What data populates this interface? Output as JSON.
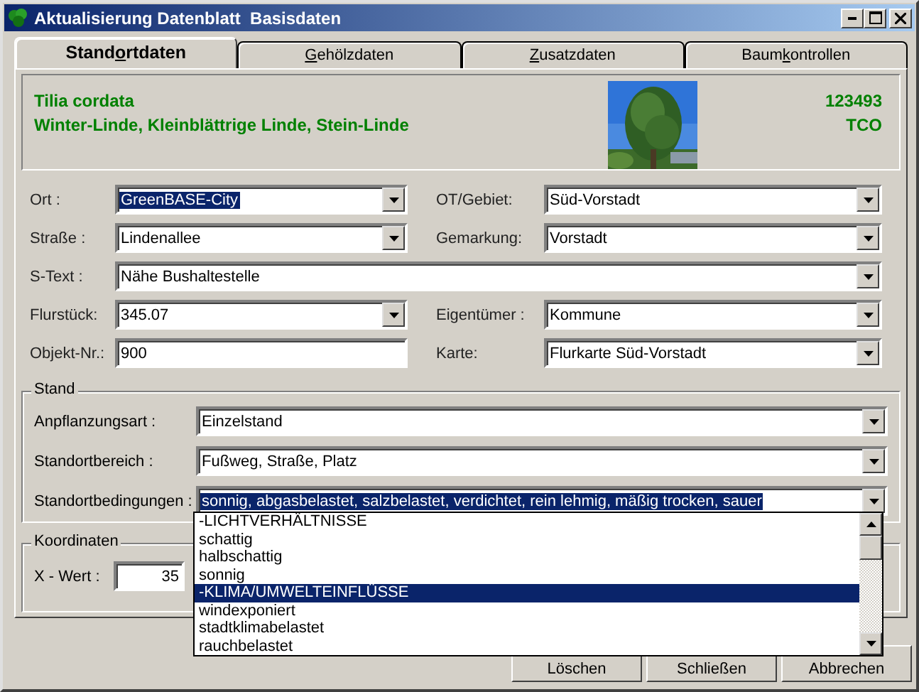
{
  "window": {
    "title": "Aktualisierung Datenblatt  Basisdaten"
  },
  "tabs": [
    {
      "before": "Stand",
      "mnemonic": "o",
      "after": "rtdaten",
      "selected": true
    },
    {
      "mnemonic": "G",
      "after": "ehölzdaten",
      "selected": false
    },
    {
      "mnemonic": "Z",
      "after": "usatzdaten",
      "selected": false
    },
    {
      "before": "Baum",
      "mnemonic": "k",
      "after": "ontrollen",
      "selected": false
    }
  ],
  "header": {
    "species": "Tilia cordata",
    "common_names": "Winter-Linde, Kleinblättrige Linde, Stein-Linde",
    "number": "123493",
    "code": "TCO"
  },
  "rows": [
    {
      "fields": [
        {
          "label": "Ort :",
          "value": "GreenBASE-City",
          "kind": "combo",
          "highlighted": true
        },
        {
          "label": "OT/Gebiet:",
          "value": "Süd-Vorstadt",
          "kind": "combo",
          "highlighted": false
        }
      ]
    },
    {
      "fields": [
        {
          "label": "Straße :",
          "value": "Lindenallee",
          "kind": "combo",
          "highlighted": false
        },
        {
          "label": "Gemarkung:",
          "value": "Vorstadt",
          "kind": "combo",
          "highlighted": false
        }
      ]
    },
    {
      "fields": [
        {
          "label": "S-Text :",
          "value": "Nähe Bushaltestelle",
          "kind": "combo",
          "highlighted": false
        }
      ]
    },
    {
      "fields": [
        {
          "label": "Flurstück:",
          "value": "345.07",
          "kind": "combo",
          "highlighted": false
        },
        {
          "label": "Eigentümer :",
          "value": "Kommune",
          "kind": "combo",
          "highlighted": false
        }
      ]
    },
    {
      "fields": [
        {
          "label": "Objekt-Nr.:",
          "value": "900",
          "kind": "text",
          "highlighted": false
        },
        {
          "label": "Karte:",
          "value": "Flurkarte Süd-Vorstadt",
          "kind": "combo",
          "highlighted": false
        }
      ]
    }
  ],
  "stand": {
    "title": "Stand",
    "fields": [
      {
        "label": "Anpflanzungsart :",
        "value": "Einzelstand",
        "highlighted": false
      },
      {
        "label": "Standortbereich :",
        "value": "Fußweg, Straße, Platz",
        "highlighted": false
      },
      {
        "label": "Standortbedingungen :",
        "value": "sonnig, abgasbelastet, salzbelastet, verdichtet, rein lehmig, mäßig trocken, sauer",
        "highlighted": true
      }
    ]
  },
  "dropdown": {
    "items": [
      {
        "label": "-LICHTVERHÄLTNISSE",
        "selected": false
      },
      {
        "label": "schattig",
        "selected": false
      },
      {
        "label": "halbschattig",
        "selected": false
      },
      {
        "label": "sonnig",
        "selected": false
      },
      {
        "label": "-KLIMA/UMWELTEINFLÜSSE",
        "selected": true
      },
      {
        "label": "windexponiert",
        "selected": false
      },
      {
        "label": "stadtklimabelastet",
        "selected": false
      },
      {
        "label": "rauchbelastet",
        "selected": false
      }
    ]
  },
  "koordinaten": {
    "title": "Koordinaten",
    "label": "X - Wert :",
    "value": "35"
  },
  "buttons": [
    "Löschen",
    "Schließen",
    "Abbrechen"
  ]
}
